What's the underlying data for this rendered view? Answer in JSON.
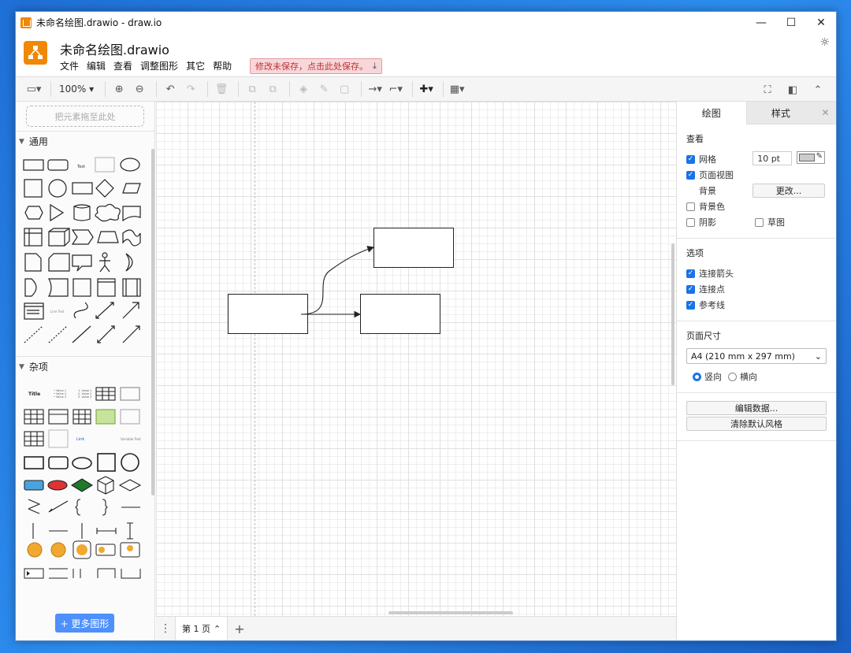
{
  "window": {
    "title": "未命名绘图.drawio - draw.io",
    "minimize": "—",
    "maximize": "☐",
    "close": "✕"
  },
  "header": {
    "doc_title": "未命名绘图.drawio",
    "menu": [
      "文件",
      "编辑",
      "查看",
      "调整图形",
      "其它",
      "帮助"
    ],
    "unsaved": "修改未保存，点击此处保存。"
  },
  "toolbar": {
    "zoom": "100%"
  },
  "sidebar": {
    "dropzone": "把元素拖至此处",
    "section_general": "通用",
    "section_misc": "杂项",
    "more_shapes": "+ 更多图形"
  },
  "footer": {
    "page_tab": "第 1 页"
  },
  "panel": {
    "tab_diagram": "绘图",
    "tab_style": "样式",
    "view": {
      "title": "查看",
      "grid": "网格",
      "grid_size": "10 pt",
      "page_view": "页面视图",
      "background": "背景",
      "change": "更改...",
      "background_color": "背景色",
      "shadow": "阴影",
      "sketch": "草图"
    },
    "options": {
      "title": "选项",
      "connection_arrows": "连接箭头",
      "connection_points": "连接点",
      "guides": "参考线"
    },
    "page_size": {
      "title": "页面尺寸",
      "selected": "A4 (210 mm x 297 mm)",
      "portrait": "竖向",
      "landscape": "横向"
    },
    "edit_data": "编辑数据...",
    "clear_style": "清除默认风格"
  },
  "colors": {
    "accent": "#1a73e8",
    "logo": "#f08705",
    "unsaved_bg": "#f8d7da",
    "more_btn": "#4d90fe"
  }
}
